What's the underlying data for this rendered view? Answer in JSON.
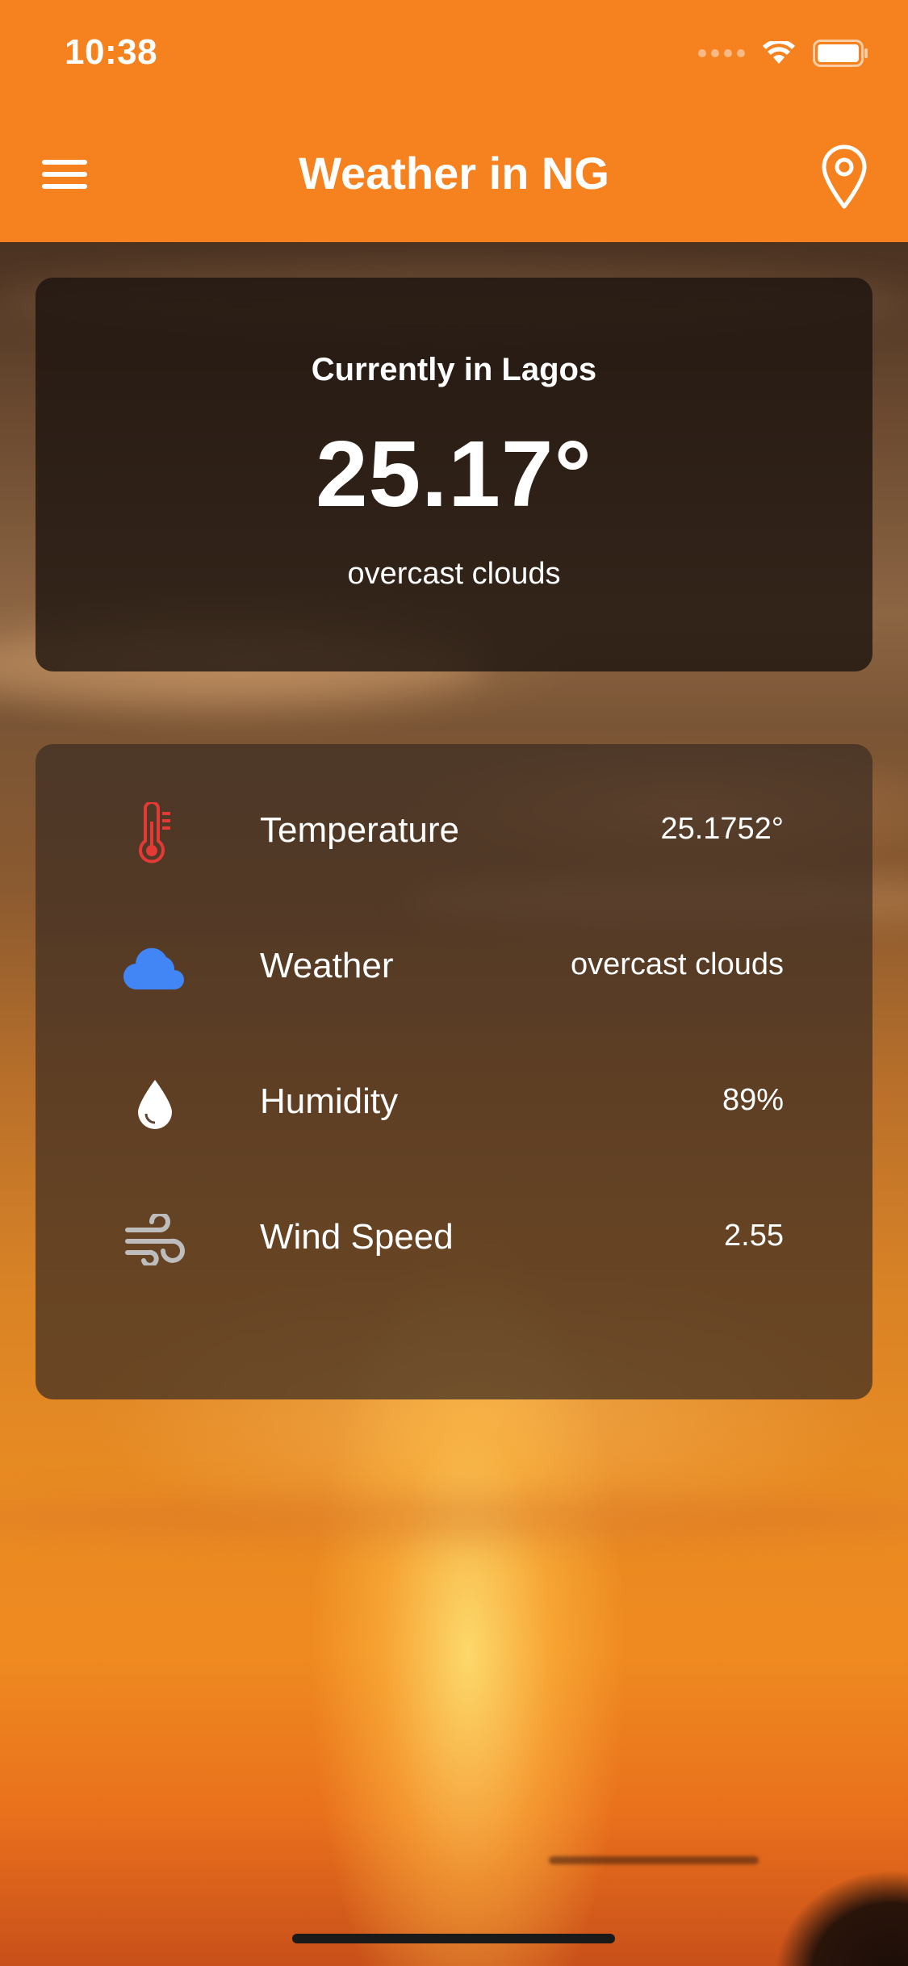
{
  "status_bar": {
    "time": "10:38"
  },
  "app_bar": {
    "title": "Weather in NG",
    "menu_icon": "hamburger-menu-icon",
    "location_icon": "location-pin-icon"
  },
  "current": {
    "label": "Currently in Lagos",
    "temperature": "25.17°",
    "description": "overcast clouds"
  },
  "details": [
    {
      "icon": "thermometer-icon",
      "label": "Temperature",
      "value": "25.1752°",
      "icon_color": "#e53935"
    },
    {
      "icon": "cloud-icon",
      "label": "Weather",
      "value": "overcast clouds",
      "icon_color": "#4285f4"
    },
    {
      "icon": "water-drop-icon",
      "label": "Humidity",
      "value": "89%",
      "icon_color": "#ffffff"
    },
    {
      "icon": "wind-icon",
      "label": "Wind Speed",
      "value": "2.55",
      "icon_color": "#bdbdbd"
    }
  ],
  "colors": {
    "accent": "#f5821f"
  }
}
